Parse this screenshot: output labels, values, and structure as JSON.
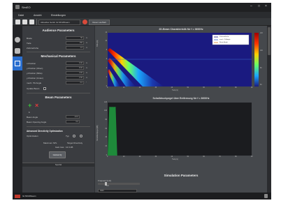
{
  "window": {
    "title": "SimEO"
  },
  "menu": {
    "items": [
      "Datei",
      "Ansicht",
      "Einstellungen"
    ]
  },
  "toolbar": {
    "device_label": "Aktuelles Gerät: Ist MC20beam",
    "reset_label": "Reset Laufbalt"
  },
  "left_tabs": [
    "Audience",
    "Mechanical",
    "Beam"
  ],
  "audience": {
    "title": "Audience Parameters",
    "fields": [
      {
        "label": "Breite",
        "value": "50",
        "unit": "m"
      },
      {
        "label": "Tiefe",
        "value": "150",
        "unit": "m"
      },
      {
        "label": "Zuhörerhöhe",
        "value": "1.6",
        "unit": "m"
      }
    ]
  },
  "mechanical": {
    "title": "Mechanical Parameters",
    "fields": [
      {
        "label": "x-Position",
        "value": "0.00",
        "unit": "m"
      },
      {
        "label": "y-Position (Oben)",
        "value": "8.00",
        "unit": "m"
      },
      {
        "label": "y-Position (Mitte)",
        "value": "4.00",
        "unit": "m"
      },
      {
        "label": "y-Position (Unten)",
        "value": "2.00",
        "unit": "m"
      },
      {
        "label": "mech. Tilt Angle",
        "value": "0.0",
        "unit": "°"
      }
    ],
    "update_label": "Update Beam"
  },
  "beam": {
    "title": "Beam Parameters",
    "index": "1",
    "angle_label": "Beam Angle",
    "angle_value": "-10.0",
    "opening_label": "Beam Opening Angle",
    "opening_value": "0.0"
  },
  "optimization": {
    "title": "Advanced Directivity Optimization",
    "opt_label": "Optimization",
    "type_label": "Typ",
    "max_label": "Maximum SPL",
    "target_label": "Target Directivity",
    "gain_label": "Gain loss",
    "gain_value": "12.3 dB",
    "button": "Global IQ"
  },
  "section_label": "Spezial",
  "plot1": {
    "title": "2D-Beam Charakteristik für f = 3600Hz",
    "xlabel": "Tiefe [m]",
    "ylabel": "Höhe [m]",
    "legend": [
      "Zuhörerfläche",
      "mech. Tilt Angle",
      "Beam Angle"
    ],
    "xticks": [
      "0",
      "10",
      "20",
      "30",
      "40",
      "50",
      "60",
      "70",
      "80",
      "90"
    ],
    "yticks": [
      "0",
      "2",
      "4",
      "6",
      "8",
      "10",
      "12"
    ],
    "colorbar": [
      "120",
      "100",
      "80",
      "60"
    ],
    "colors": {
      "background": "#1a1a80",
      "line": "#3a6ad0"
    }
  },
  "chart_data": {
    "type": "area",
    "title": "Schalldruckpegel über Entfernung für f = 3600Hz",
    "xlabel": "Tiefe [m]",
    "ylabel": "Schalldruckpegel [dB]",
    "x": [
      0,
      1,
      2,
      3,
      4,
      5,
      6,
      7,
      8
    ],
    "series": [
      {
        "values": [
          0,
          110,
          110,
          110,
          110,
          110,
          0,
          0,
          0
        ]
      }
    ],
    "xticks": [
      "0",
      "10",
      "20",
      "30",
      "40",
      "50",
      "60",
      "70",
      "80",
      "90"
    ],
    "yticks": [
      "0",
      "20",
      "40",
      "60",
      "80",
      "100",
      "120"
    ],
    "colors": {
      "fill": "#1e8a3a"
    }
  },
  "simulation": {
    "title": "Simulation Parameters",
    "freq_label": "Frequenz [Hz]",
    "freq_value": "3600",
    "scale_value": "100"
  },
  "status": {
    "text": "Ist MC20beam"
  }
}
